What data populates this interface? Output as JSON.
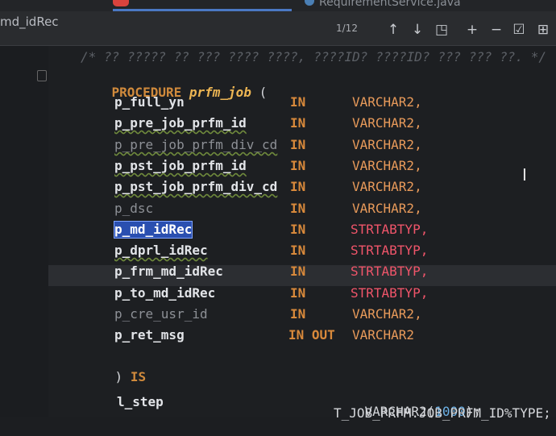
{
  "tabs": {
    "other_tab": "RequirementService.java"
  },
  "find": {
    "query": "md_idRec",
    "match_count": "1/12",
    "buttons": [
      {
        "name": "prev-occurrence-button",
        "icon": "arrow-up-icon",
        "glyph": "↑"
      },
      {
        "name": "next-occurrence-button",
        "icon": "arrow-down-icon",
        "glyph": "↓"
      },
      {
        "name": "open-in-window-button",
        "icon": "window-icon",
        "glyph": "◳"
      },
      {
        "name": "add-selection-button",
        "icon": "add-occurrence-icon",
        "glyph": "+"
      },
      {
        "name": "remove-selection-button",
        "icon": "remove-occurrence-icon",
        "glyph": "−"
      },
      {
        "name": "select-all-button",
        "icon": "select-all-icon",
        "glyph": "☑"
      },
      {
        "name": "match-case-button",
        "icon": "match-case-icon",
        "glyph": "⊞"
      }
    ]
  },
  "code": {
    "comment": "/* ?? ????? ?? ??? ???? ????, ????ID? ????ID? ??? ??? ??. */",
    "procedure_kw": "PROCEDURE",
    "procedure_name": "prfm_job",
    "open_paren": "(",
    "params": [
      {
        "name": "p_full_yn",
        "mode": "IN",
        "type": "VARCHAR2,",
        "dim": false,
        "squig": false,
        "red": false
      },
      {
        "name": "p_pre_job_prfm_id",
        "mode": "IN",
        "type": "VARCHAR2,",
        "dim": false,
        "squig": true,
        "red": false
      },
      {
        "name": "p_pre_job_prfm_div_cd",
        "mode": "IN",
        "type": "VARCHAR2,",
        "dim": true,
        "squig": true,
        "red": false
      },
      {
        "name": "p_pst_job_prfm_id",
        "mode": "IN",
        "type": "VARCHAR2,",
        "dim": false,
        "squig": true,
        "red": false
      },
      {
        "name": "p_pst_job_prfm_div_cd",
        "mode": "IN",
        "type": "VARCHAR2,",
        "dim": false,
        "squig": true,
        "red": false
      },
      {
        "name": "p_dsc",
        "mode": "IN",
        "type": "VARCHAR2,",
        "dim": true,
        "squig": false,
        "red": false
      },
      {
        "name": "p_md_idRec",
        "mode": "IN",
        "type": "STRTABTYP,",
        "dim": false,
        "squig": false,
        "red": true,
        "selected": true
      },
      {
        "name": "p_dprl_idRec",
        "mode": "IN",
        "type": "STRTABTYP,",
        "dim": false,
        "squig": true,
        "red": true
      },
      {
        "name": "p_frm_md_idRec",
        "mode": "IN",
        "type": "STRTABTYP,",
        "dim": false,
        "squig": false,
        "red": true
      },
      {
        "name": "p_to_md_idRec",
        "mode": "IN",
        "type": "STRTABTYP,",
        "dim": false,
        "squig": false,
        "red": true
      },
      {
        "name": "p_cre_usr_id",
        "mode": "IN",
        "type": "VARCHAR2,",
        "dim": true,
        "squig": false,
        "red": false
      },
      {
        "name": "p_ret_msg",
        "mode": "IN OUT",
        "type": "VARCHAR2",
        "dim": false,
        "squig": false,
        "red": false
      }
    ],
    "close_paren": ")",
    "is_kw": "IS",
    "var_name": "l_step",
    "var_type": "VARCHAR2(",
    "var_size": "1000",
    "var_end": ");",
    "last_line": "T_JOB_PRFM.JOB_PRFM_ID%TYPE;"
  },
  "colors": {
    "keyword": "#d08a3c",
    "procedure_name": "#ecb553",
    "type_red": "#f0556a",
    "selection": "#2a4fb0"
  }
}
